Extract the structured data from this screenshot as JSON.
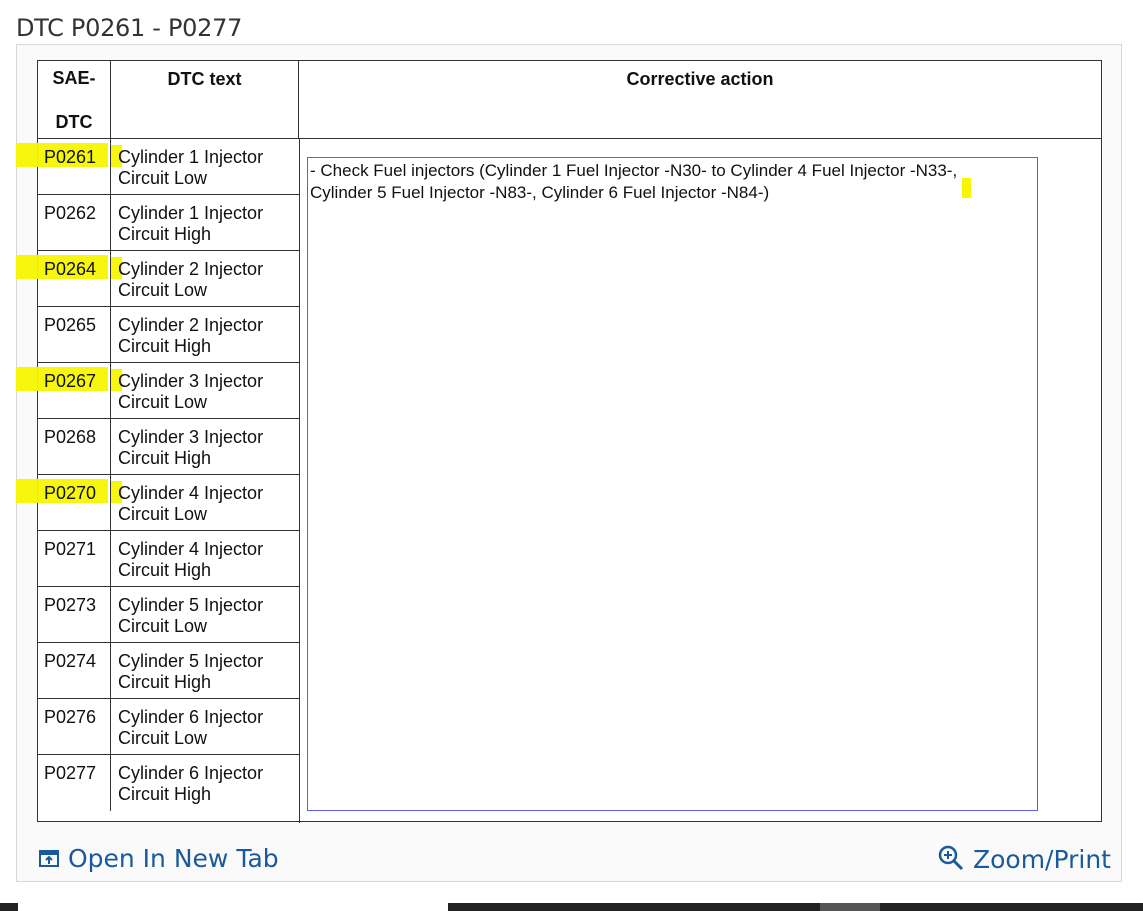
{
  "page": {
    "title": "DTC P0261 - P0277"
  },
  "table": {
    "headers": {
      "sae_line1": "SAE-",
      "sae_line2": "DTC",
      "dtc_text": "DTC text",
      "corrective_action": "Corrective action"
    },
    "rows": [
      {
        "code": "P0261",
        "line1": "Cylinder 1 Injector",
        "line2": "Circuit Low",
        "highlighted": true
      },
      {
        "code": "P0262",
        "line1": "Cylinder 1 Injector",
        "line2": "Circuit High",
        "highlighted": false
      },
      {
        "code": "P0264",
        "line1": "Cylinder 2 Injector",
        "line2": "Circuit Low",
        "highlighted": true
      },
      {
        "code": "P0265",
        "line1": "Cylinder 2 Injector",
        "line2": "Circuit High",
        "highlighted": false
      },
      {
        "code": "P0267",
        "line1": "Cylinder 3 Injector",
        "line2": "Circuit Low",
        "highlighted": true
      },
      {
        "code": "P0268",
        "line1": "Cylinder 3 Injector",
        "line2": "Circuit High",
        "highlighted": false
      },
      {
        "code": "P0270",
        "line1": "Cylinder 4 Injector",
        "line2": "Circuit Low",
        "highlighted": true
      },
      {
        "code": "P0271",
        "line1": "Cylinder 4 Injector",
        "line2": "Circuit High",
        "highlighted": false
      },
      {
        "code": "P0273",
        "line1": "Cylinder 5 Injector",
        "line2": "Circuit Low",
        "highlighted": false
      },
      {
        "code": "P0274",
        "line1": "Cylinder 5 Injector",
        "line2": "Circuit High",
        "highlighted": false
      },
      {
        "code": "P0276",
        "line1": "Cylinder 6 Injector",
        "line2": "Circuit Low",
        "highlighted": false
      },
      {
        "code": "P0277",
        "line1": "Cylinder 6 Injector",
        "line2": "Circuit High",
        "highlighted": false
      }
    ],
    "corrective_action": {
      "line1": "- Check Fuel injectors (Cylinder 1 Fuel Injector -N30- to Cylinder 4 Fuel Injector -N33-,",
      "line2": "Cylinder 5 Fuel Injector -N83-, Cylinder 6 Fuel Injector -N84-)"
    }
  },
  "footer": {
    "open_tab": "Open In New Tab",
    "zoom_print": "Zoom/Print"
  },
  "colors": {
    "highlight": "#f7f500",
    "link": "#1a5a9c",
    "action_border": "#5c5cff"
  },
  "icons": {
    "open_tab": "open-in-new-tab-icon",
    "zoom": "zoom-in-icon"
  }
}
